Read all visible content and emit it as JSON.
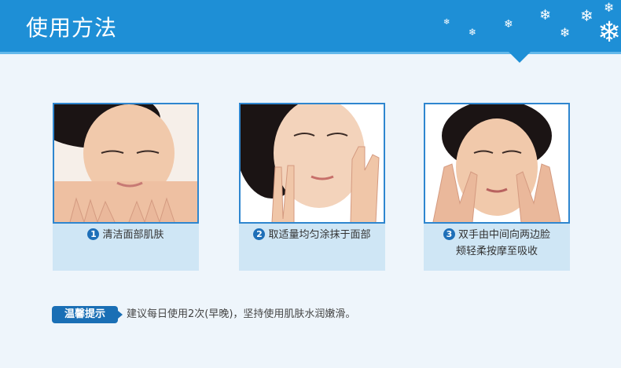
{
  "header": {
    "title": "使用方法"
  },
  "steps": [
    {
      "number": "1",
      "text": "清洁面部肌肤"
    },
    {
      "number": "2",
      "text": "取适量均匀涂抹于面部"
    },
    {
      "number": "3",
      "text": "双手由中间向两边脸",
      "text2": "颊轻柔按摩至吸收"
    }
  ],
  "tip": {
    "label": "温馨提示",
    "text": "建议每日使用2次(早晚)，坚持使用肌肤水润嫩滑。"
  },
  "colors": {
    "header": "#1e8fd6",
    "accent": "#1a6fb5",
    "card": "#cfe6f5"
  }
}
